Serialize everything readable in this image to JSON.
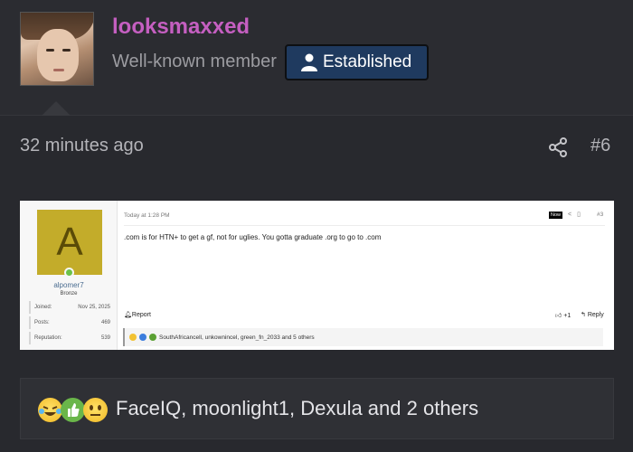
{
  "header": {
    "username": "looksmaxxed",
    "user_title": "Well-known member",
    "badge": {
      "label": "Established",
      "icon": "user-icon",
      "color": "#1f3a5f"
    },
    "username_color": "#c55fc1"
  },
  "post": {
    "time": "32 minutes ago",
    "number": "#6",
    "share_icon": "share-icon"
  },
  "embedded_screenshot": {
    "avatar_letter": "A",
    "username": "alpomer7",
    "rank": "Bronze",
    "stats": [
      {
        "label": "Joined:",
        "value": "Nov 25, 2025"
      },
      {
        "label": "Posts:",
        "value": "469"
      },
      {
        "label": "Reputation:",
        "value": "539"
      }
    ],
    "post_time": "Today at 1:28 PM",
    "now_tag": "Now",
    "post_number": "#3",
    "text": ".com is for HTN+ to get a gf, not for uglies. You gotta graduate .org to go to .com",
    "report": "Report",
    "plus": "+1",
    "reply": "Reply",
    "reactions": "SouthAfricancell, unkownincel, green_fn_2033 and 5 others"
  },
  "reactions": {
    "icons": [
      "laughing-crying-emoji-icon",
      "thumbs-up-icon",
      "neutral-face-emoji-icon"
    ],
    "text": "FaceIQ, moonlight1, Dexula and 2 others"
  }
}
